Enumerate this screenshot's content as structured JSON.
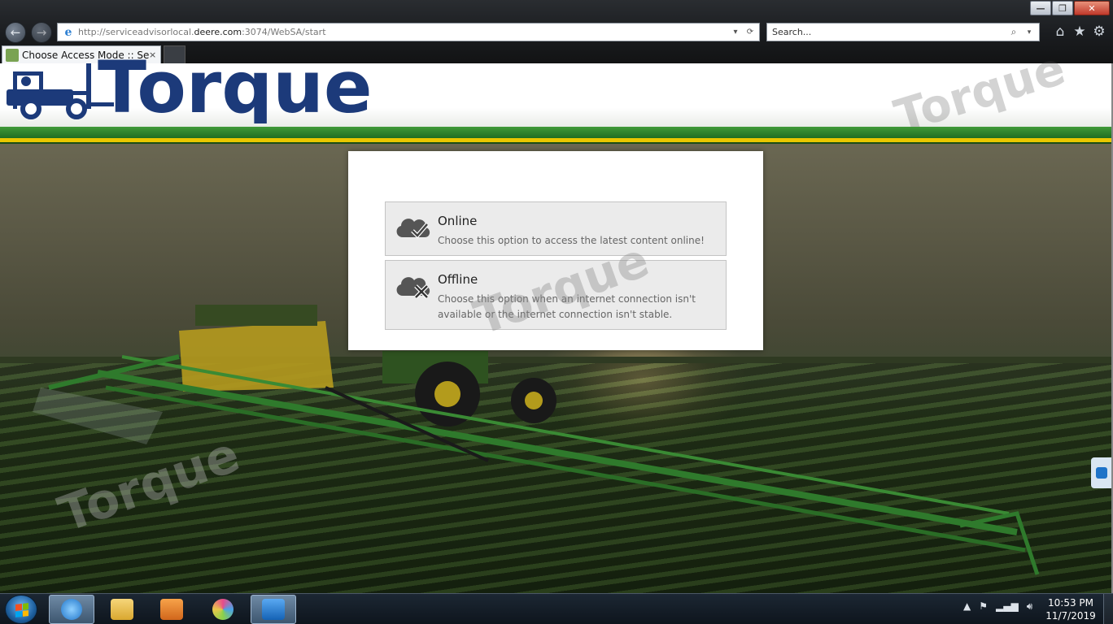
{
  "browser": {
    "url_prefix": "http://serviceadvisorlocal.",
    "url_domain": "deere.com",
    "url_suffix": ":3074/WebSA/start",
    "search_placeholder": "Search...",
    "tab_title": "Choose Access Mode :: Ser...",
    "tab_close": "×",
    "window_controls": {
      "minimize": "—",
      "maximize": "❐",
      "close": "✕"
    },
    "toolbar_icons": [
      "home-icon",
      "favorites-star-icon",
      "settings-gear-icon"
    ]
  },
  "header": {
    "logo_text": "Torque",
    "watermark_text": "Torque"
  },
  "dialog": {
    "options": [
      {
        "title": "Online",
        "description": "Choose this option to access the latest content online!",
        "icon": "cloud-check-icon"
      },
      {
        "title": "Offline",
        "description": "Choose this option when an internet connection isn't available or the internet connection isn't stable.",
        "icon": "cloud-x-icon"
      }
    ]
  },
  "taskbar": {
    "clock_time": "10:53 PM",
    "clock_date": "11/7/2019",
    "pinned": [
      "internet-explorer-icon",
      "file-explorer-icon",
      "media-player-icon",
      "pinwheel-app-icon",
      "teamviewer-icon"
    ]
  },
  "colors": {
    "deere_green": "#367c2b",
    "deere_yellow": "#e9c700",
    "logo_blue": "#1c3a7a",
    "logo_navy": "#1f2a4f"
  }
}
